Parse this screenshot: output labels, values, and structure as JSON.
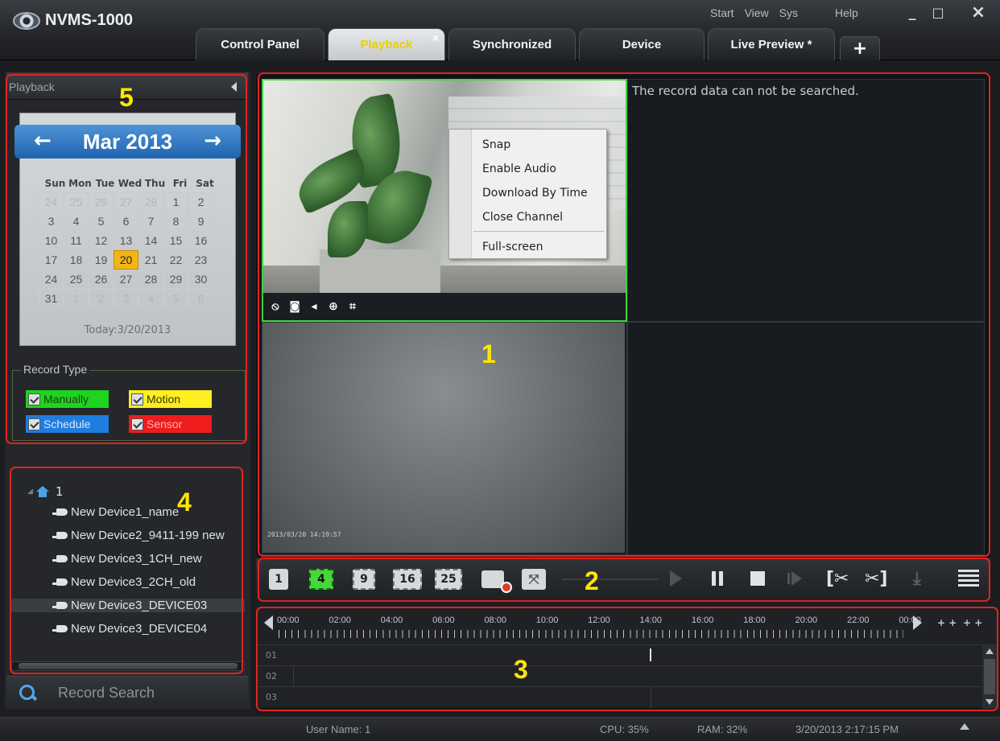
{
  "app": {
    "title": "NVMS-1000"
  },
  "top_menu": {
    "start": "Start",
    "view": "View",
    "sys": "Sys",
    "help": "Help"
  },
  "window_controls": {
    "minimize": "_",
    "maximize": "□",
    "close": "×"
  },
  "tabs": [
    {
      "label": "Control Panel",
      "active": false
    },
    {
      "label": "Playback",
      "active": true,
      "close": "×"
    },
    {
      "label": "Synchronized",
      "active": false
    },
    {
      "label": "Device",
      "active": false
    },
    {
      "label": "Live Preview *",
      "active": false
    }
  ],
  "tab_add": "+",
  "left_panel": {
    "title": "Playback",
    "calendar": {
      "month_label": "Mar  2013",
      "prev": "←",
      "next": "→",
      "weekdays": [
        "Sun",
        "Mon",
        "Tue",
        "Wed",
        "Thu",
        "Fri",
        "Sat"
      ],
      "days": [
        {
          "d": "24",
          "dim": true
        },
        {
          "d": "25",
          "dim": true
        },
        {
          "d": "26",
          "dim": true
        },
        {
          "d": "27",
          "dim": true
        },
        {
          "d": "28",
          "dim": true
        },
        {
          "d": "1"
        },
        {
          "d": "2"
        },
        {
          "d": "3"
        },
        {
          "d": "4"
        },
        {
          "d": "5"
        },
        {
          "d": "6"
        },
        {
          "d": "7"
        },
        {
          "d": "8"
        },
        {
          "d": "9"
        },
        {
          "d": "10"
        },
        {
          "d": "11"
        },
        {
          "d": "12"
        },
        {
          "d": "13"
        },
        {
          "d": "14"
        },
        {
          "d": "15"
        },
        {
          "d": "16"
        },
        {
          "d": "17"
        },
        {
          "d": "18"
        },
        {
          "d": "19"
        },
        {
          "d": "20",
          "today": true
        },
        {
          "d": "21"
        },
        {
          "d": "22"
        },
        {
          "d": "23"
        },
        {
          "d": "24"
        },
        {
          "d": "25"
        },
        {
          "d": "26"
        },
        {
          "d": "27"
        },
        {
          "d": "28"
        },
        {
          "d": "29"
        },
        {
          "d": "30"
        },
        {
          "d": "31"
        },
        {
          "d": "1",
          "dim": true
        },
        {
          "d": "2",
          "dim": true
        },
        {
          "d": "3",
          "dim": true
        },
        {
          "d": "4",
          "dim": true
        },
        {
          "d": "5",
          "dim": true
        },
        {
          "d": "6",
          "dim": true
        }
      ],
      "today_label": "Today:3/20/2013"
    },
    "record_type": {
      "title": "Record Type",
      "items": [
        {
          "label": "Manually",
          "bg": "#1fd41f",
          "color": "#1a3a1a"
        },
        {
          "label": "Motion",
          "bg": "#ffee22",
          "color": "#3a3500"
        },
        {
          "label": "Schedule",
          "bg": "#1e7de0",
          "color": "#dde9f8"
        },
        {
          "label": "Sensor",
          "bg": "#ee1c1c",
          "color": "#ffb0b0"
        }
      ]
    },
    "tree": {
      "root": "1",
      "devices": [
        "New Device1_name",
        "New Device2_9411-199 new",
        "New Device3_1CH_new",
        "New Device3_2CH_old",
        "New Device3_DEVICE03",
        "New Device3_DEVICE04"
      ],
      "selected_index": 4
    },
    "record_search": "Record Search"
  },
  "video": {
    "no_record_message": "The record data can not be searched.",
    "timestamp": "2013/03/20 14:19:57",
    "context_menu": [
      "Snap",
      "Enable Audio",
      "Download By Time",
      "Close Channel",
      "Full-screen"
    ],
    "channel_toolbar_icons": [
      "stop-record-icon",
      "snapshot-icon",
      "mute-icon",
      "zoom-in-icon",
      "fit-screen-icon"
    ]
  },
  "controls": {
    "layouts": [
      "1",
      "4",
      "9",
      "16",
      "25"
    ],
    "active_layout": "4"
  },
  "timeline": {
    "hours": [
      "00:00",
      "02:00",
      "04:00",
      "06:00",
      "08:00",
      "10:00",
      "12:00",
      "14:00",
      "16:00",
      "18:00",
      "20:00",
      "22:00",
      "00:00"
    ],
    "zoom_in": "+ +",
    "zoom_out": "+ +",
    "channels": [
      "01",
      "02",
      "03"
    ]
  },
  "status": {
    "user": "User Name: 1",
    "cpu": "CPU: 35%",
    "ram": "RAM: 32%",
    "datetime": "3/20/2013 2:17:15 PM"
  },
  "annotations": [
    "1",
    "2",
    "3",
    "4",
    "5"
  ],
  "colors": {
    "accent_green": "#42d33a",
    "annotation_red": "#e2231f",
    "annotation_number": "#ffe600",
    "calendar_blue": "#1f64b0",
    "today_orange": "#f2b515"
  }
}
